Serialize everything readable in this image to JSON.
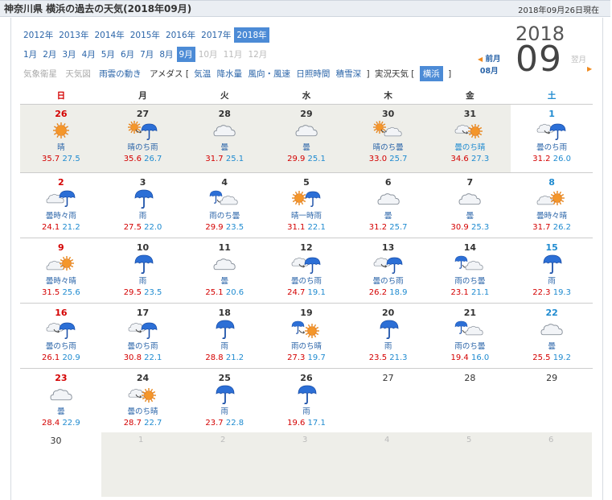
{
  "header": {
    "title": "神奈川県 横浜の過去の天気(2018年09月)",
    "current": "2018年09月26日現在"
  },
  "years": [
    {
      "label": "2012年",
      "active": false
    },
    {
      "label": "2013年",
      "active": false
    },
    {
      "label": "2014年",
      "active": false
    },
    {
      "label": "2015年",
      "active": false
    },
    {
      "label": "2016年",
      "active": false
    },
    {
      "label": "2017年",
      "active": false
    },
    {
      "label": "2018年",
      "active": true
    }
  ],
  "months": [
    {
      "label": "1月",
      "state": "link"
    },
    {
      "label": "2月",
      "state": "link"
    },
    {
      "label": "3月",
      "state": "link"
    },
    {
      "label": "4月",
      "state": "link"
    },
    {
      "label": "5月",
      "state": "link"
    },
    {
      "label": "6月",
      "state": "link"
    },
    {
      "label": "7月",
      "state": "link"
    },
    {
      "label": "8月",
      "state": "link"
    },
    {
      "label": "9月",
      "state": "active"
    },
    {
      "label": "10月",
      "state": "disabled"
    },
    {
      "label": "11月",
      "state": "disabled"
    },
    {
      "label": "12月",
      "state": "disabled"
    }
  ],
  "links": {
    "satellite": "気象衛星",
    "weathermap": "天気図",
    "rain_cloud": "雨雲の動き",
    "amedas": "アメダス [",
    "temp": "気温",
    "precip": "降水量",
    "wind": "風向・風速",
    "sunshine": "日照時間",
    "snow": "積雪深",
    "close1": "]",
    "actual": "実況天気 [",
    "yokohama": "横浜",
    "close2": "]"
  },
  "big_year": "2018",
  "big_month": "09",
  "prev_label": "前月",
  "prev_month": "08月",
  "next_label": "翌月",
  "weekdays": [
    "日",
    "月",
    "火",
    "水",
    "木",
    "金",
    "土"
  ],
  "weeks": [
    [
      {
        "day": "26",
        "out": true,
        "icon": "sunny-icon",
        "w": "晴",
        "max": "35.7",
        "min": "27.5"
      },
      {
        "day": "27",
        "out": true,
        "icon": "sunny-then-rain-icon",
        "w": "晴のち雨",
        "max": "35.6",
        "min": "26.7"
      },
      {
        "day": "28",
        "out": true,
        "icon": "cloudy-icon",
        "w": "曇",
        "max": "31.7",
        "min": "25.1"
      },
      {
        "day": "29",
        "out": true,
        "icon": "cloudy-icon",
        "w": "曇",
        "max": "29.9",
        "min": "25.1"
      },
      {
        "day": "30",
        "out": true,
        "icon": "sunny-then-cloudy-icon",
        "w": "晴のち曇",
        "max": "33.0",
        "min": "25.7"
      },
      {
        "day": "31",
        "out": true,
        "icon": "cloudy-then-sunny-icon",
        "w": "曇のち晴",
        "max": "34.6",
        "min": "27.3"
      },
      {
        "day": "1",
        "out": false,
        "icon": "cloudy-then-rain-icon",
        "w": "曇のち雨",
        "max": "31.2",
        "min": "26.0"
      }
    ],
    [
      {
        "day": "2",
        "icon": "cloudy-occasional-rain-icon",
        "w": "曇時々雨",
        "max": "24.1",
        "min": "21.2"
      },
      {
        "day": "3",
        "icon": "rain-icon",
        "w": "雨",
        "max": "27.5",
        "min": "22.0"
      },
      {
        "day": "4",
        "icon": "rain-then-cloudy-icon",
        "w": "雨のち曇",
        "max": "29.9",
        "min": "23.5"
      },
      {
        "day": "5",
        "icon": "sunny-briefly-rain-icon",
        "w": "晴一時雨",
        "max": "31.1",
        "min": "22.1"
      },
      {
        "day": "6",
        "icon": "cloudy-icon",
        "w": "曇",
        "max": "31.2",
        "min": "25.7"
      },
      {
        "day": "7",
        "icon": "cloudy-icon",
        "w": "曇",
        "max": "30.9",
        "min": "25.3"
      },
      {
        "day": "8",
        "icon": "cloudy-occasional-sunny-icon",
        "w": "曇時々晴",
        "max": "31.7",
        "min": "26.2"
      }
    ],
    [
      {
        "day": "9",
        "icon": "cloudy-occasional-sunny-icon",
        "w": "曇時々晴",
        "max": "31.5",
        "min": "25.6"
      },
      {
        "day": "10",
        "icon": "rain-icon",
        "w": "雨",
        "max": "29.5",
        "min": "23.5"
      },
      {
        "day": "11",
        "icon": "cloudy-icon",
        "w": "曇",
        "max": "25.1",
        "min": "20.6"
      },
      {
        "day": "12",
        "icon": "cloudy-then-rain-icon",
        "w": "曇のち雨",
        "max": "24.7",
        "min": "19.1"
      },
      {
        "day": "13",
        "icon": "cloudy-then-rain-icon",
        "w": "曇のち雨",
        "max": "26.2",
        "min": "18.9"
      },
      {
        "day": "14",
        "icon": "rain-then-cloudy-icon",
        "w": "雨のち曇",
        "max": "23.1",
        "min": "21.1"
      },
      {
        "day": "15",
        "icon": "rain-icon",
        "w": "雨",
        "max": "22.3",
        "min": "19.3"
      }
    ],
    [
      {
        "day": "16",
        "icon": "cloudy-then-rain-icon",
        "w": "曇のち雨",
        "max": "26.1",
        "min": "20.9"
      },
      {
        "day": "17",
        "icon": "cloudy-then-rain-icon",
        "w": "曇のち雨",
        "max": "30.8",
        "min": "22.1"
      },
      {
        "day": "18",
        "icon": "rain-icon",
        "w": "雨",
        "max": "28.8",
        "min": "21.2"
      },
      {
        "day": "19",
        "icon": "rain-then-sunny-icon",
        "w": "雨のち晴",
        "max": "27.3",
        "min": "19.7"
      },
      {
        "day": "20",
        "icon": "rain-icon",
        "w": "雨",
        "max": "23.5",
        "min": "21.3"
      },
      {
        "day": "21",
        "icon": "rain-then-cloudy-icon",
        "w": "雨のち曇",
        "max": "19.4",
        "min": "16.0"
      },
      {
        "day": "22",
        "icon": "cloudy-icon",
        "w": "曇",
        "max": "25.5",
        "min": "19.2"
      }
    ],
    [
      {
        "day": "23",
        "icon": "cloudy-icon",
        "w": "曇",
        "max": "28.4",
        "min": "22.9"
      },
      {
        "day": "24",
        "icon": "cloudy-then-sunny-icon",
        "w": "曇のち晴",
        "max": "28.7",
        "min": "22.7"
      },
      {
        "day": "25",
        "icon": "rain-icon",
        "w": "雨",
        "max": "23.7",
        "min": "22.8"
      },
      {
        "day": "26",
        "icon": "rain-icon",
        "w": "雨",
        "max": "19.6",
        "min": "17.1"
      },
      {
        "day": "27",
        "plain": true
      },
      {
        "day": "28",
        "plain": true
      },
      {
        "day": "29",
        "plain": true
      }
    ]
  ],
  "last_row": {
    "day30": "30",
    "next": [
      "1",
      "2",
      "3",
      "4",
      "5",
      "6"
    ]
  },
  "colors": {
    "accent": "#4c8bd6",
    "link": "#2a64a8",
    "sunday": "#d40000",
    "saturday": "#1f8bd0",
    "outside": "#eeeee9"
  }
}
